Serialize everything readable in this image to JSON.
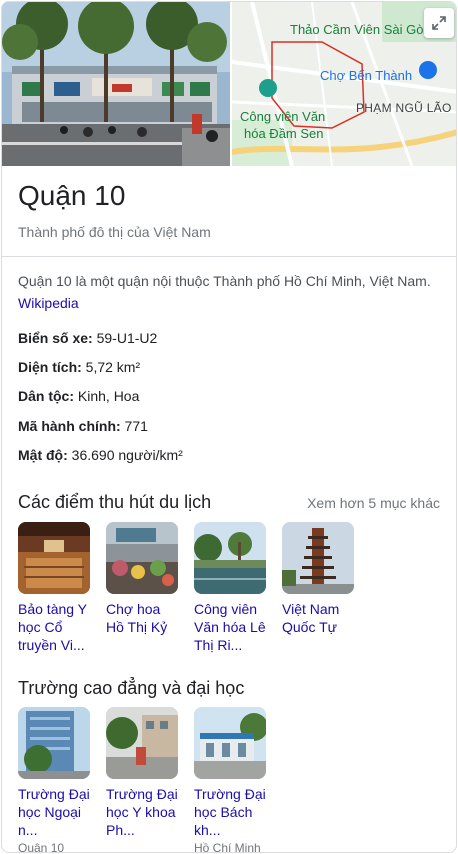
{
  "hero": {
    "map_labels": {
      "zoo": "Thảo Cầm Viên Sài Gò",
      "market": "Chợ Bến Thành",
      "park_line1": "Công viên Văn",
      "park_line2": "hóa Đầm Sen",
      "street": "PHẠM NGŨ LÃO"
    }
  },
  "header": {
    "title": "Quận 10",
    "subtitle": "Thành phố đô thị của Việt Nam"
  },
  "description": {
    "text": "Quận 10 là một quận nội thuộc Thành phố Hồ Chí Minh, Việt Nam. ",
    "link": "Wikipedia"
  },
  "facts": [
    {
      "label": "Biển số xe:",
      "value": " 59-U1-U2"
    },
    {
      "label": "Diện tích:",
      "value": " 5,72 km²"
    },
    {
      "label": "Dân tộc:",
      "value": " Kinh, Hoa"
    },
    {
      "label": "Mã hành chính:",
      "value": " 771"
    },
    {
      "label": "Mật độ:",
      "value": " 36.690 người/km²"
    }
  ],
  "attractions": {
    "title": "Các điểm thu hút du lịch",
    "more": "Xem hơn 5 mục khác",
    "items": [
      {
        "label": "Bảo tàng Y học Cổ truyền Vi..."
      },
      {
        "label": "Chợ hoa Hồ Thị Kỷ"
      },
      {
        "label": "Công viên Văn hóa Lê Thị Ri..."
      },
      {
        "label": "Việt Nam Quốc Tự"
      }
    ]
  },
  "colleges": {
    "title": "Trường cao đẳng và đại học",
    "items": [
      {
        "label": "Trường Đại học Ngoại n...",
        "sub": "Quận 10"
      },
      {
        "label": "Trường Đại học Y khoa Ph...",
        "sub": ""
      },
      {
        "label": "Trường Đại học Bách kh...",
        "sub": "Hồ Chí Minh"
      }
    ]
  },
  "colors": {
    "link": "#1a0dab",
    "map_green": "#188038",
    "map_blue": "#1a73e8",
    "district_outline": "#d93025"
  }
}
